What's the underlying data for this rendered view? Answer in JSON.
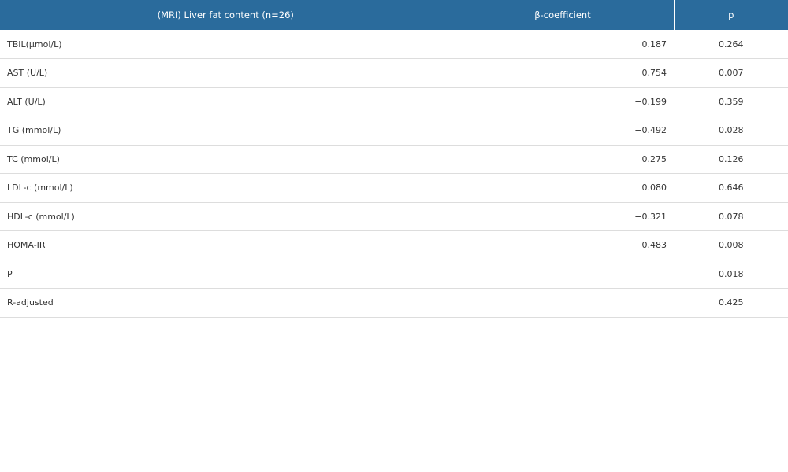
{
  "table": {
    "headers": [
      "(MRI) Liver fat content (n=26)",
      "β-coefficient",
      "p"
    ],
    "rows": [
      {
        "label": "TBIL(μmol/L)",
        "beta": "0.187",
        "p": "0.264"
      },
      {
        "label": "AST (U/L)",
        "beta": "0.754",
        "p": "0.007"
      },
      {
        "label": "ALT (U/L)",
        "beta": "−0.199",
        "p": "0.359"
      },
      {
        "label": "TG (mmol/L)",
        "beta": "−0.492",
        "p": "0.028"
      },
      {
        "label": "TC (mmol/L)",
        "beta": "0.275",
        "p": "0.126"
      },
      {
        "label": "LDL-c (mmol/L)",
        "beta": "0.080",
        "p": "0.646"
      },
      {
        "label": "HDL-c (mmol/L)",
        "beta": "−0.321",
        "p": "0.078"
      },
      {
        "label": "HOMA-IR",
        "beta": "0.483",
        "p": "0.008"
      },
      {
        "label": "P",
        "beta": "",
        "p": "0.018"
      },
      {
        "label": "R-adjusted",
        "beta": "",
        "p": "0.425"
      }
    ]
  },
  "colors": {
    "header_bg": "#2a6b9c",
    "header_text": "#ffffff",
    "row_border": "#dddddd",
    "body_text": "#333333"
  }
}
